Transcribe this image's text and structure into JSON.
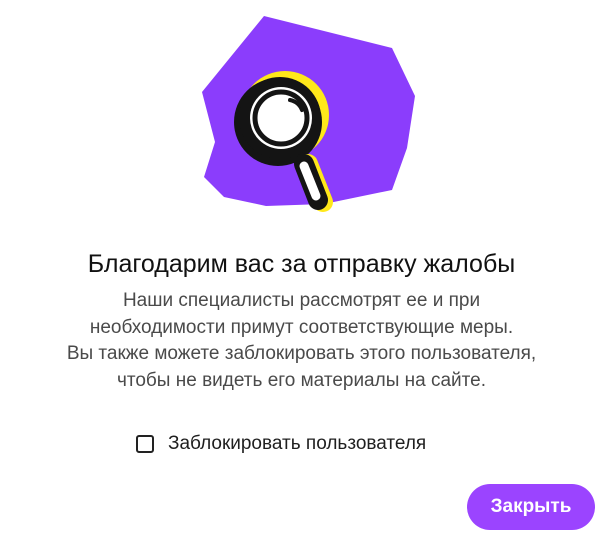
{
  "dialog": {
    "title": "Благодарим вас за отправку жалобы",
    "message_lines": [
      "Наши специалисты рассмотрят ее и при",
      "необходимости примут соответствующие меры.",
      "Вы также можете заблокировать этого пользователя,",
      "чтобы не видеть его материалы на сайте."
    ],
    "block_checkbox": {
      "label": "Заблокировать пользователя",
      "checked": false
    },
    "close_button_label": "Закрыть",
    "illustration_icon": "magnifier-icon"
  },
  "colors": {
    "accent": "#9b44ff",
    "illustration_bg": "#8b3dfc",
    "highlight": "#ffe81a"
  }
}
